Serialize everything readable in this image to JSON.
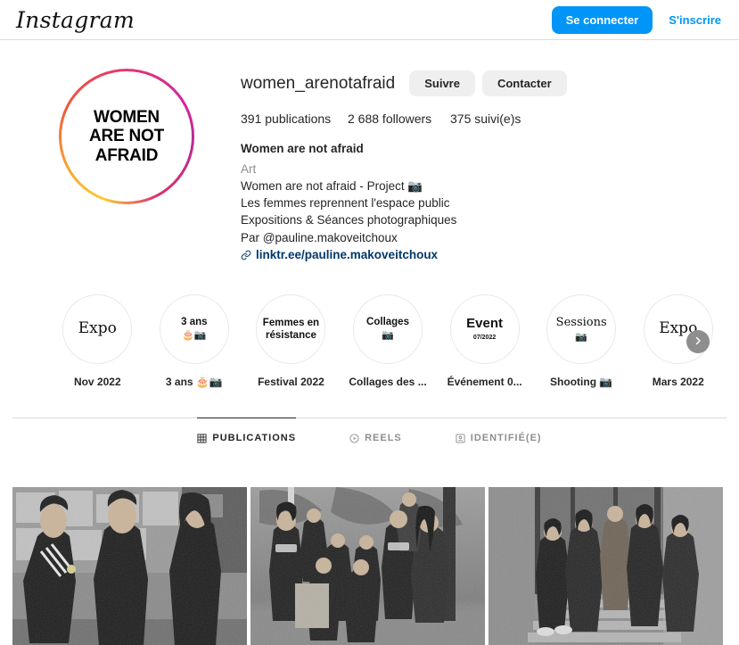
{
  "topnav": {
    "logo": "Instagram",
    "login_label": "Se connecter",
    "signup_label": "S'inscrire"
  },
  "profile": {
    "username": "women_arenotafraid",
    "avatar_text": "WOMEN\nARE NOT\nAFRAID",
    "avatar_line1": "WOMEN",
    "avatar_line2": "ARE NOT",
    "avatar_line3": "AFRAID",
    "follow_label": "Suivre",
    "contact_label": "Contacter",
    "stats": {
      "posts": "391 publications",
      "followers": "2 688 followers",
      "following": "375 suivi(e)s"
    },
    "bio_name": "Women are not afraid",
    "bio_category": "Art",
    "bio_lines": [
      "Women are not afraid - Project 📷",
      "Les femmes reprennent l'espace public",
      "Expositions & Séances photographiques",
      "Par @pauline.makoveitchoux"
    ],
    "bio_link": "linktr.ee/pauline.makoveitchoux",
    "link_icon": "link-icon"
  },
  "highlights": {
    "next_icon": "chevron-right-icon",
    "items": [
      {
        "cover_text": "Expo",
        "cover_style": "serif",
        "cover_sub": "",
        "cover_emoji": "",
        "label": "Nov 2022"
      },
      {
        "cover_text": "3 ans",
        "cover_style": "bold",
        "cover_sub": "",
        "cover_emoji": "🎂📷",
        "label": "3 ans 🎂📷"
      },
      {
        "cover_text": "Femmes en résistance",
        "cover_style": "bold",
        "cover_sub": "",
        "cover_emoji": "",
        "label": "Festival 2022"
      },
      {
        "cover_text": "Collages",
        "cover_style": "bold",
        "cover_sub": "",
        "cover_emoji": "📷",
        "label": "Collages des ..."
      },
      {
        "cover_text": "Event",
        "cover_style": "bold-lg",
        "cover_sub": "07/2022",
        "cover_emoji": "",
        "label": "Événement 0..."
      },
      {
        "cover_text": "Sessions",
        "cover_style": "serif-sm",
        "cover_sub": "",
        "cover_emoji": "📷",
        "label": "Shooting 📷"
      },
      {
        "cover_text": "Expo",
        "cover_style": "serif",
        "cover_sub": "",
        "cover_emoji": "",
        "label": "Mars 2022"
      }
    ]
  },
  "tabs": [
    {
      "label": "PUBLICATIONS",
      "icon": "grid-icon",
      "active": true
    },
    {
      "label": "REELS",
      "icon": "reels-icon",
      "active": false
    },
    {
      "label": "IDENTIFIÉ(E)",
      "icon": "tagged-icon",
      "active": false
    }
  ],
  "grid": {
    "posts": [
      {
        "alt": "Trois femmes devant un mur couvert d'affiches, photo noir et blanc"
      },
      {
        "alt": "Groupe de personnes posant dans une rue avec graffitis, photo noir et blanc"
      },
      {
        "alt": "Cinq personnes devant un escalier et une porte, photo noir et blanc"
      }
    ]
  },
  "colors": {
    "accent_blue": "#0095f6",
    "link_navy": "#00376b",
    "text_primary": "#262626",
    "text_secondary": "#8e8e8e",
    "border": "#dbdbdb",
    "button_grey": "#efefef"
  }
}
